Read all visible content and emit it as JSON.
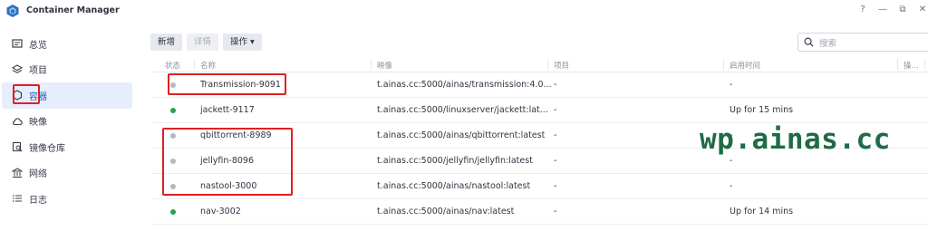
{
  "app": {
    "title": "Container Manager",
    "window_controls": [
      "?",
      "—",
      "⧉",
      "✕"
    ]
  },
  "sidebar": {
    "items": [
      {
        "label": "总览",
        "icon": "overview-icon"
      },
      {
        "label": "项目",
        "icon": "project-icon"
      },
      {
        "label": "容器",
        "icon": "container-icon",
        "active": true
      },
      {
        "label": "映像",
        "icon": "image-icon"
      },
      {
        "label": "镜像仓库",
        "icon": "registry-icon"
      },
      {
        "label": "网络",
        "icon": "network-icon"
      },
      {
        "label": "日志",
        "icon": "log-icon"
      }
    ]
  },
  "toolbar": {
    "add_label": "新增",
    "details_label": "详情",
    "action_label": "操作 ▾"
  },
  "search": {
    "placeholder": "搜索"
  },
  "table": {
    "headers": [
      "状态",
      "名称",
      "映像",
      "项目",
      "启用时间",
      "操..."
    ],
    "rows": [
      {
        "status": "stopped",
        "name": "Transmission-9091",
        "image": "t.ainas.cc:5000/ainas/transmission:4.0...",
        "project": "-",
        "uptime": "-"
      },
      {
        "status": "running",
        "name": "jackett-9117",
        "image": "t.ainas.cc:5000/linuxserver/jackett:lat...",
        "project": "-",
        "uptime": "Up for 15 mins"
      },
      {
        "status": "stopped",
        "name": "qbittorrent-8989",
        "image": "t.ainas.cc:5000/ainas/qbittorrent:latest",
        "project": "-",
        "uptime": "-"
      },
      {
        "status": "stopped",
        "name": "jellyfin-8096",
        "image": "t.ainas.cc:5000/jellyfin/jellyfin:latest",
        "project": "-",
        "uptime": "-"
      },
      {
        "status": "stopped",
        "name": "nastool-3000",
        "image": "t.ainas.cc:5000/ainas/nastool:latest",
        "project": "-",
        "uptime": "-"
      },
      {
        "status": "running",
        "name": "nav-3002",
        "image": "t.ainas.cc:5000/ainas/nav:latest",
        "project": "-",
        "uptime": "Up for 14 mins"
      }
    ]
  },
  "colors": {
    "running": "#27a34a",
    "stopped": "#b4b8be",
    "active_nav_bg": "#e6eefb",
    "annotation_red": "#e02020",
    "watermark": "#1f6b46"
  },
  "watermark": "wp.ainas.cc"
}
